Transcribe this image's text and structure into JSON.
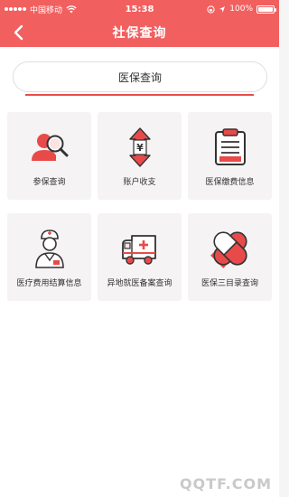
{
  "status_bar": {
    "carrier": "中国移动",
    "time": "15:38",
    "battery": "100%",
    "battery_level": 1.0
  },
  "nav": {
    "title": "社保查询"
  },
  "tab": {
    "label": "医保查询"
  },
  "cards": [
    {
      "label": "参保查询",
      "icon": "person-search-icon"
    },
    {
      "label": "账户收支",
      "icon": "yuan-arrows-icon"
    },
    {
      "label": "医保缴费信息",
      "icon": "clipboard-icon"
    },
    {
      "label": "医疗费用结算信息",
      "icon": "doctor-icon"
    },
    {
      "label": "异地就医备案查询",
      "icon": "ambulance-icon"
    },
    {
      "label": "医保三目录查询",
      "icon": "pill-icon"
    }
  ],
  "watermark": "QQTF.COM",
  "colors": {
    "accent": "#f25f5f",
    "icon_red": "#e84a4a",
    "card_bg": "#f5f3f3"
  }
}
